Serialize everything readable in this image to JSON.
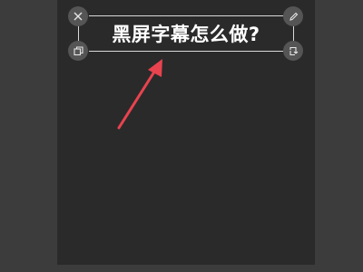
{
  "caption": {
    "text": "黑屏字幕怎么做?"
  },
  "handles": {
    "top_left": "close-icon",
    "top_right": "edit-icon",
    "bottom_left": "copy-icon",
    "bottom_right": "rotate-icon"
  },
  "colors": {
    "background": "#3c3c3c",
    "canvas": "#2a2a2a",
    "text": "#ffffff",
    "frame": "#d8d8d8",
    "handle": "#555555",
    "arrow": "#e8434f"
  }
}
